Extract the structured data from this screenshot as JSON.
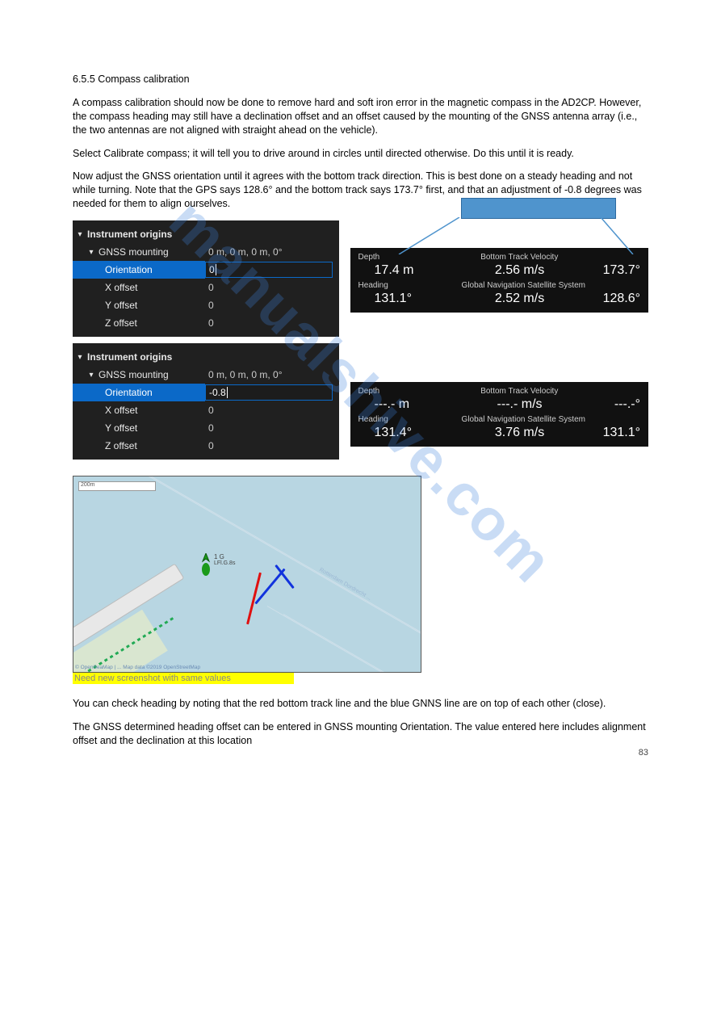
{
  "section_num": "6.5.5",
  "section_title": "Compass calibration",
  "intro": [
    "A compass calibration should now be done to remove hard and soft iron error in the magnetic compass in the AD2CP. However, the compass heading may still have a declination offset and an offset caused by the mounting of the GNSS antenna array (i.e., the two antennas are not aligned with straight ahead on the vehicle).",
    "Select Calibrate compass; it will tell you to drive around in circles until directed otherwise. Do this until it is ready.",
    "Now adjust the GNSS orientation until it agrees with the bottom track direction. This is best done on a steady heading and not while turning. Note that the GPS says 128.6° and the bottom track says 173.7° first, and that an adjustment of -0.8 degrees was needed for them to align ourselves."
  ],
  "panel1": {
    "header": "Instrument origins",
    "sub": "GNSS mounting",
    "sub_val": "0 m, 0 m, 0 m, 0°",
    "orientation_label": "Orientation",
    "orientation_val": "0",
    "xoff_label": "X offset",
    "xoff": "0",
    "yoff_label": "Y offset",
    "yoff": "0",
    "zoff_label": "Z offset",
    "zoff": "0"
  },
  "status1": {
    "depth_lbl": "Depth",
    "btv_lbl": "Bottom Track Velocity",
    "depth": "17.4 m",
    "btv_spd": "2.56 m/s",
    "btv_dir": "173.7°",
    "hdg_lbl": "Heading",
    "gnss_lbl": "Global Navigation Satellite System",
    "hdg": "131.1°",
    "gnss_spd": "2.52 m/s",
    "gnss_dir": "128.6°"
  },
  "panel2": {
    "header": "Instrument origins",
    "sub": "GNSS mounting",
    "sub_val": "0 m, 0 m, 0 m, 0°",
    "orientation_label": "Orientation",
    "orientation_val": "-0.8",
    "xoff_label": "X offset",
    "xoff": "0",
    "yoff_label": "Y offset",
    "yoff": "0",
    "zoff_label": "Z offset",
    "zoff": "0"
  },
  "status2": {
    "depth_lbl": "Depth",
    "btv_lbl": "Bottom Track Velocity",
    "depth": "---.- m",
    "btv_spd": "---.- m/s",
    "btv_dir": "---.-°",
    "hdg_lbl": "Heading",
    "gnss_lbl": "Global Navigation Satellite System",
    "hdg": "131.4°",
    "gnss_spd": "3.76 m/s",
    "gnss_dir": "131.1°"
  },
  "map": {
    "marker_label": "1 G",
    "marker_sub": "LFl.G.8s",
    "credit": "© OpenSeaMap | ... Map data ©2019 OpenStreetMap",
    "scale": "200m",
    "lane": "Rotterdam Dordrecht ..."
  },
  "caption": "Need new screenshot with same values",
  "outro": [
    "You can check heading by noting that the red bottom track line and the blue GNNS line are on top of each other (close).",
    "The GNSS determined heading offset can be entered in GNSS mounting Orientation. The value entered here includes alignment offset and the declination at this location"
  ],
  "page_num": "83"
}
